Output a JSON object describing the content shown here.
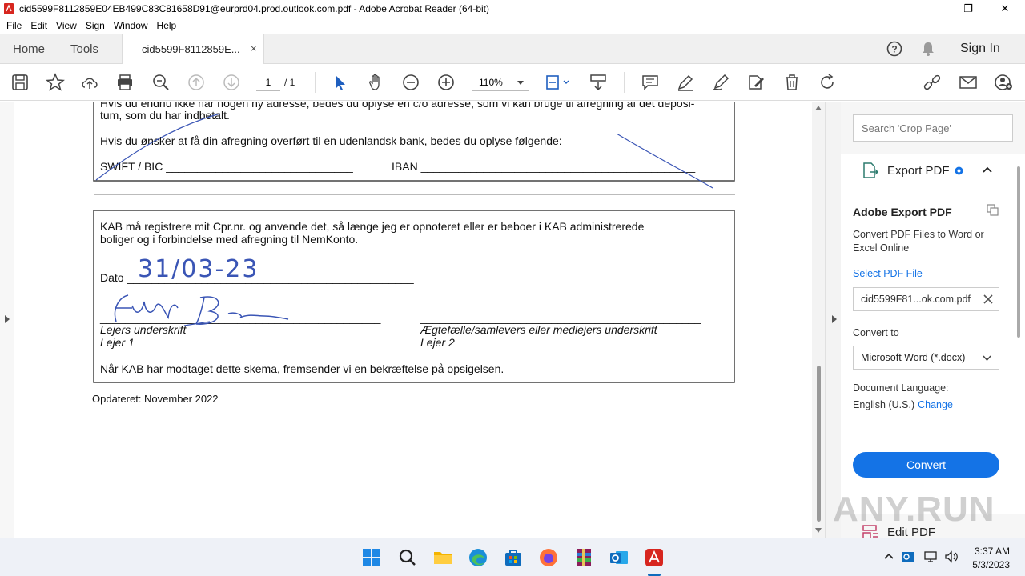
{
  "window": {
    "title": "cid5599F8112859E04EB499C83C81658D91@eurprd04.prod.outlook.com.pdf - Adobe Acrobat Reader (64-bit)",
    "minimize": "—",
    "maximize": "❐",
    "close": "✕"
  },
  "menu": [
    "File",
    "Edit",
    "View",
    "Sign",
    "Window",
    "Help"
  ],
  "tabs": {
    "home": "Home",
    "tools": "Tools",
    "doc": "cid5599F8112859E...",
    "close": "×",
    "signin": "Sign In"
  },
  "toolbar": {
    "page_current": "1",
    "page_total": "/ 1",
    "zoom": "110%"
  },
  "document": {
    "line1": "Hvis du endnu ikke har nogen ny adresse, bedes du oplyse en c/o adresse, som vi kan bruge til afregning af det deposi-",
    "line2": "tum, som du har indbetalt.",
    "line3": "Hvis du ønsker at få din afregning overført til en udenlandsk bank, bedes du oplyse følgende:",
    "swift": "SWIFT / BIC ______________________________",
    "iban": "IBAN ____________________________________________",
    "cpr1": "KAB må registrere mit Cpr.nr. og anvende det, så længe jeg er opnoteret eller er beboer i KAB administrerede",
    "cpr2": "boliger og i forbindelse med afregning til NemKonto.",
    "dato": "Dato ______________________________________________",
    "dato_value": "31/03-23",
    "sig1_line": "_____________________________________________",
    "sig2_line": "_____________________________________________",
    "sig1_label": "Lejers underskrift",
    "sig1_sub": "Lejer 1",
    "sig2_label": "Ægtefælle/samlevers eller medlejers underskrift",
    "sig2_sub": "Lejer 2",
    "confirm": "Når KAB har modtaget dette skema, fremsender vi en bekræftelse på opsigelsen.",
    "updated": "Opdateret: November 2022"
  },
  "panel": {
    "search_placeholder": "Search 'Crop Page'",
    "export_title": "Export PDF",
    "heading": "Adobe Export PDF",
    "desc": "Convert PDF Files to Word or Excel Online",
    "select_file": "Select PDF File",
    "file_name": "cid5599F81...ok.com.pdf",
    "convert_to": "Convert to",
    "format": "Microsoft Word (*.docx)",
    "doc_lang_label": "Document Language:",
    "doc_lang": "English (U.S.)",
    "change": "Change",
    "convert_btn": "Convert",
    "edit_pdf": "Edit PDF"
  },
  "taskbar": {
    "time": "3:37 AM",
    "date": "5/3/2023"
  },
  "watermark": "ANY.RUN",
  "colors": {
    "accent": "#1473e6",
    "ink": "#3a55b5"
  }
}
